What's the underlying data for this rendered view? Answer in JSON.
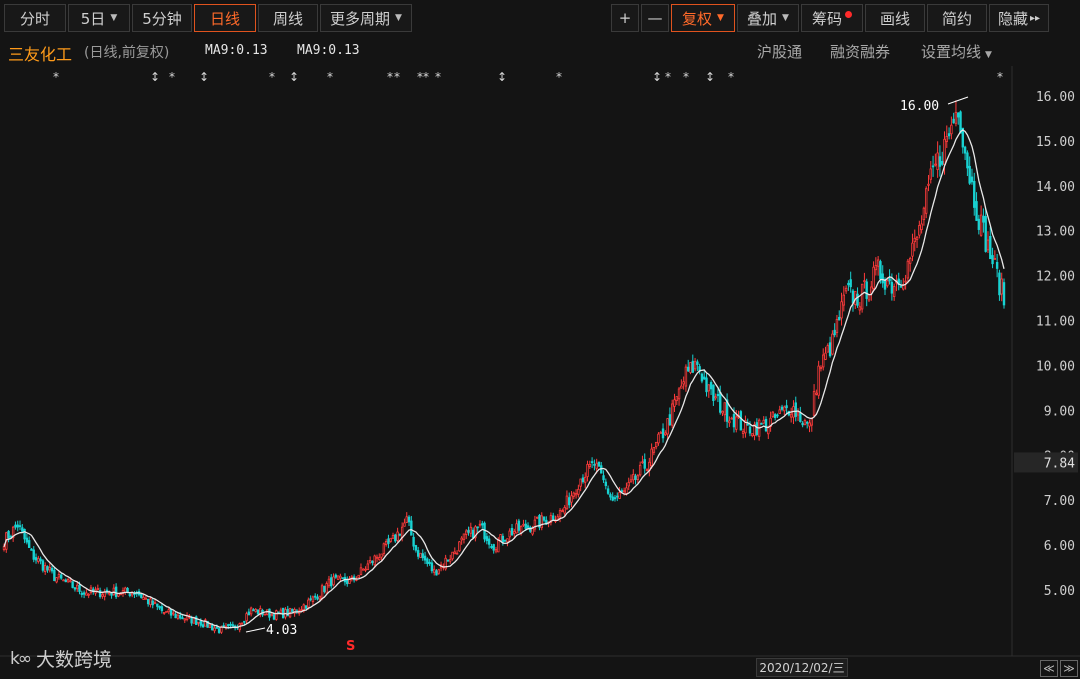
{
  "toolbar": {
    "items": [
      {
        "label": "分时"
      },
      {
        "label": "5日",
        "dropdown": true
      },
      {
        "label": "5分钟"
      },
      {
        "label": "日线",
        "active": true
      },
      {
        "label": "周线"
      },
      {
        "label": "更多周期",
        "dropdown": true
      }
    ],
    "right_items": [
      {
        "label": "+",
        "icon": "plus-icon"
      },
      {
        "label": "—",
        "icon": "minus-icon"
      },
      {
        "label": "复权",
        "dropdown": true,
        "active": true
      },
      {
        "label": "叠加",
        "dropdown": true
      },
      {
        "label": "筹码",
        "badge": true
      },
      {
        "label": "画线"
      },
      {
        "label": "简约"
      },
      {
        "label": "隐藏",
        "arrows": "▸▸"
      }
    ]
  },
  "info": {
    "title": "三友化工",
    "subtitle": "(日线,前复权)",
    "ma_label_1": "MA9:0.13",
    "ma_label_2": "MA9:0.13",
    "links": [
      "沪股通",
      "融资融券",
      "设置均线"
    ]
  },
  "footer": {
    "date": "2020/12/02/三",
    "watermark": "大数跨境",
    "watermark_mark": "k∞"
  },
  "colors": {
    "up": "#ff3b3b",
    "down": "#18d2d2",
    "ma": "#e8e8e8",
    "accent": "#ff6a2a",
    "bg": "#141414"
  },
  "chart_data": {
    "type": "candlestick",
    "ylim": [
      4.0,
      16.3
    ],
    "y_ticks": [
      5.0,
      6.0,
      7.0,
      8.0,
      9.0,
      10.0,
      11.0,
      12.0,
      13.0,
      14.0,
      15.0,
      16.0
    ],
    "y_tick_labels": [
      "5.00",
      "6.00",
      "7.00",
      "8.00",
      "9.00",
      "10.00",
      "11.00",
      "12.00",
      "13.00",
      "14.00",
      "15.00",
      "16.00"
    ],
    "current_price": "7.84",
    "annotations": {
      "high": "16.00",
      "low": "4.03"
    },
    "signal_marker": "S",
    "event_marker_glyphs": [
      "*",
      "↕"
    ],
    "ma_series": {
      "name": "MA9"
    },
    "price_path": [
      [
        0,
        6.1
      ],
      [
        6,
        6.45
      ],
      [
        12,
        5.8
      ],
      [
        22,
        5.3
      ],
      [
        35,
        4.95
      ],
      [
        50,
        4.95
      ],
      [
        58,
        4.95
      ],
      [
        63,
        4.75
      ],
      [
        70,
        4.5
      ],
      [
        85,
        4.3
      ],
      [
        95,
        4.1
      ],
      [
        100,
        4.15
      ],
      [
        108,
        4.55
      ],
      [
        118,
        4.45
      ],
      [
        126,
        4.5
      ],
      [
        134,
        4.75
      ],
      [
        143,
        5.2
      ],
      [
        152,
        5.2
      ],
      [
        160,
        5.6
      ],
      [
        170,
        6.1
      ],
      [
        176,
        6.55
      ],
      [
        180,
        5.9
      ],
      [
        188,
        5.4
      ],
      [
        196,
        5.8
      ],
      [
        202,
        6.2
      ],
      [
        208,
        6.4
      ],
      [
        214,
        6.0
      ],
      [
        222,
        6.3
      ],
      [
        234,
        6.5
      ],
      [
        244,
        6.75
      ],
      [
        252,
        7.5
      ],
      [
        258,
        7.8
      ],
      [
        266,
        7.0
      ],
      [
        272,
        7.2
      ],
      [
        282,
        7.9
      ],
      [
        290,
        8.7
      ],
      [
        298,
        9.8
      ],
      [
        303,
        10.05
      ],
      [
        308,
        9.4
      ],
      [
        315,
        9.0
      ],
      [
        324,
        8.6
      ],
      [
        334,
        8.7
      ],
      [
        344,
        9.1
      ],
      [
        352,
        8.6
      ],
      [
        356,
        9.9
      ],
      [
        362,
        10.5
      ],
      [
        368,
        11.6
      ],
      [
        374,
        11.5
      ],
      [
        382,
        12.1
      ],
      [
        388,
        11.8
      ],
      [
        394,
        12.1
      ],
      [
        400,
        13.0
      ],
      [
        406,
        14.3
      ],
      [
        412,
        15.0
      ],
      [
        417,
        15.8
      ],
      [
        421,
        14.5
      ],
      [
        425,
        13.5
      ],
      [
        429,
        12.8
      ],
      [
        434,
        12.0
      ],
      [
        437,
        11.5
      ]
    ],
    "grid": false
  }
}
